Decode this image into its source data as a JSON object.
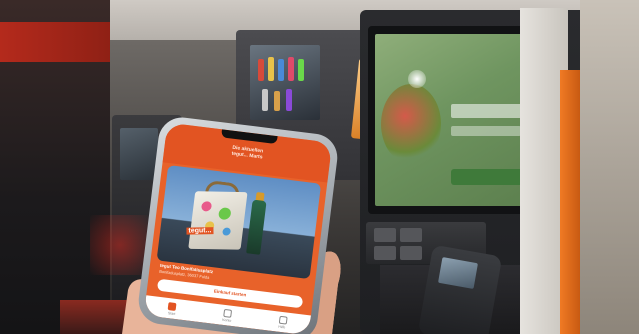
{
  "app_screen": {
    "headline": "Die aktuellen\ntegut... Marts",
    "bag_logo": "tegut...",
    "store_title": "tegut Teo Bonifatiusplatz",
    "store_subtitle": "Bonifatiusplatz, 36037 Fulda",
    "cta_label": "Einkauf starten",
    "tabs": [
      {
        "label": "Start",
        "icon": "home-icon",
        "active": true
      },
      {
        "label": "Konto",
        "icon": "account-icon",
        "active": false
      },
      {
        "label": "Hilfe",
        "icon": "help-icon",
        "active": false
      }
    ]
  },
  "colors": {
    "brand_orange": "#e25422",
    "kiosk_screen_green": "#6f9560",
    "pillar_orange": "#f07a24"
  }
}
